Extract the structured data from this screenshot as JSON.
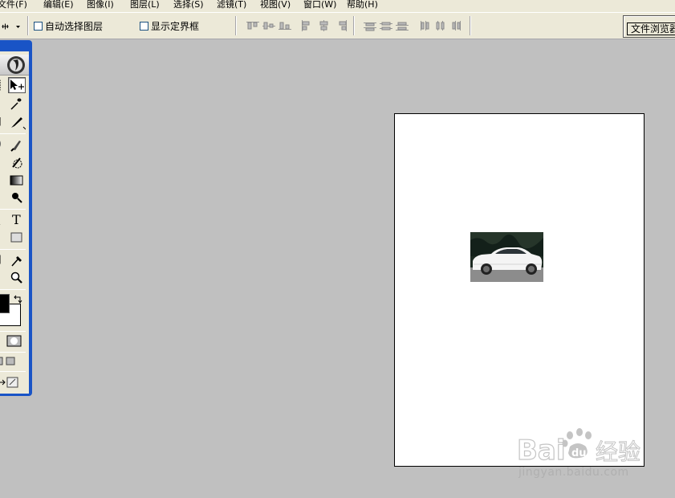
{
  "menu": {
    "items": [
      {
        "label": "文件(F)"
      },
      {
        "label": "编辑(E)"
      },
      {
        "label": "图像(I)"
      },
      {
        "label": "图层(L)"
      },
      {
        "label": "选择(S)"
      },
      {
        "label": "滤镜(T)"
      },
      {
        "label": "视图(V)"
      },
      {
        "label": "窗口(W)"
      },
      {
        "label": "帮助(H)"
      }
    ]
  },
  "options": {
    "auto_select_label": "自动选择图层",
    "auto_select_checked": false,
    "show_bounds_label": "显示定界框",
    "show_bounds_checked": false,
    "file_browser_label": "文件浏览器"
  },
  "toolbox": {
    "selected_tool": "move-tool",
    "type_tool_glyph": "T"
  },
  "colors": {
    "background": "#c0c0c0",
    "ui_face": "#ece9d8",
    "toolbox_frame": "#1954c6",
    "foreground_swatch": "#000000",
    "background_swatch": "#ffffff"
  },
  "watermark": {
    "brand": "Baidu经验",
    "url": "jingyan.baidu.com"
  }
}
